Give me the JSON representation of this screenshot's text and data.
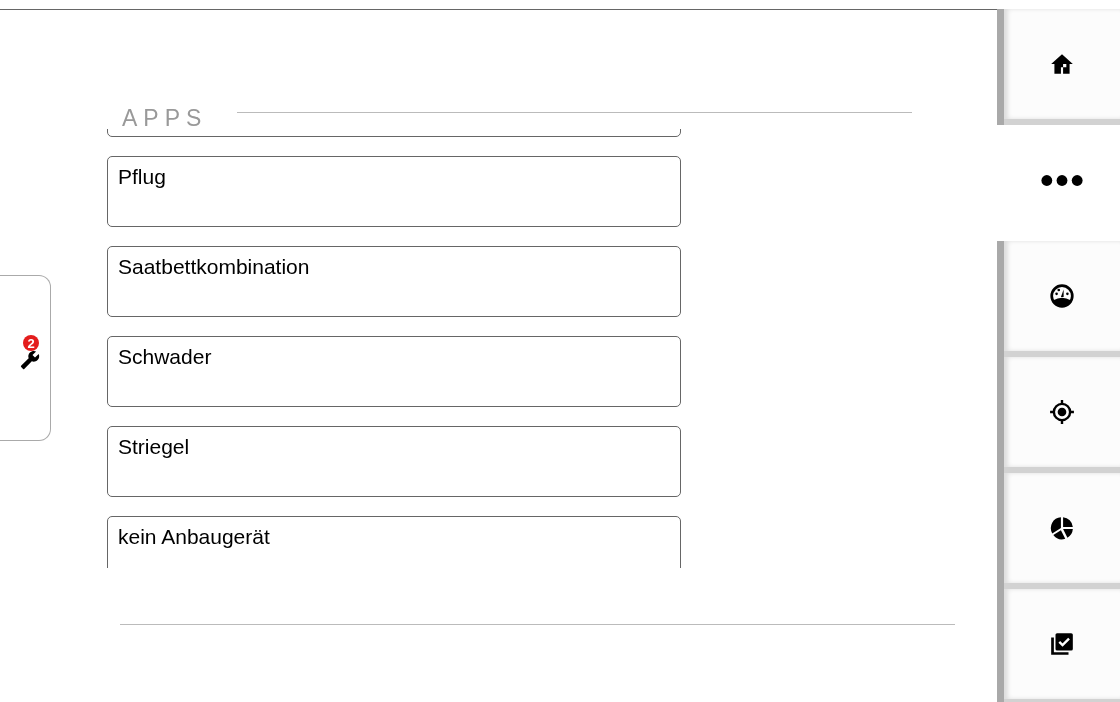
{
  "header": {
    "title": "APPS"
  },
  "apps": [
    {
      "label": "Pflug"
    },
    {
      "label": "Saatbettkombination"
    },
    {
      "label": "Schwader"
    },
    {
      "label": "Striegel"
    },
    {
      "label": "kein Anbaugerät"
    }
  ],
  "tools_tab": {
    "badge": "2"
  },
  "nav": [
    {
      "kind": "home",
      "selected": false
    },
    {
      "kind": "more",
      "selected": true
    },
    {
      "kind": "gauge",
      "selected": false
    },
    {
      "kind": "target",
      "selected": false
    },
    {
      "kind": "pie",
      "selected": false
    },
    {
      "kind": "checklist",
      "selected": false
    }
  ]
}
